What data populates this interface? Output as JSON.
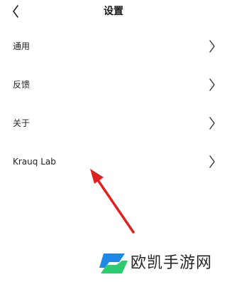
{
  "header": {
    "title": "设置",
    "back_icon": "chevron-left-icon"
  },
  "settings": {
    "items": [
      {
        "label": "通用",
        "icon": "chevron-right-icon"
      },
      {
        "label": "反馈",
        "icon": "chevron-right-icon"
      },
      {
        "label": "关于",
        "icon": "chevron-right-icon"
      },
      {
        "label": "Krauq Lab",
        "icon": "chevron-right-icon"
      }
    ]
  },
  "annotation": {
    "arrow_color": "#e02020"
  },
  "watermark": {
    "text": "欧凯手游网",
    "logo_colors": [
      "#1e88e5",
      "#2ecc71"
    ]
  }
}
